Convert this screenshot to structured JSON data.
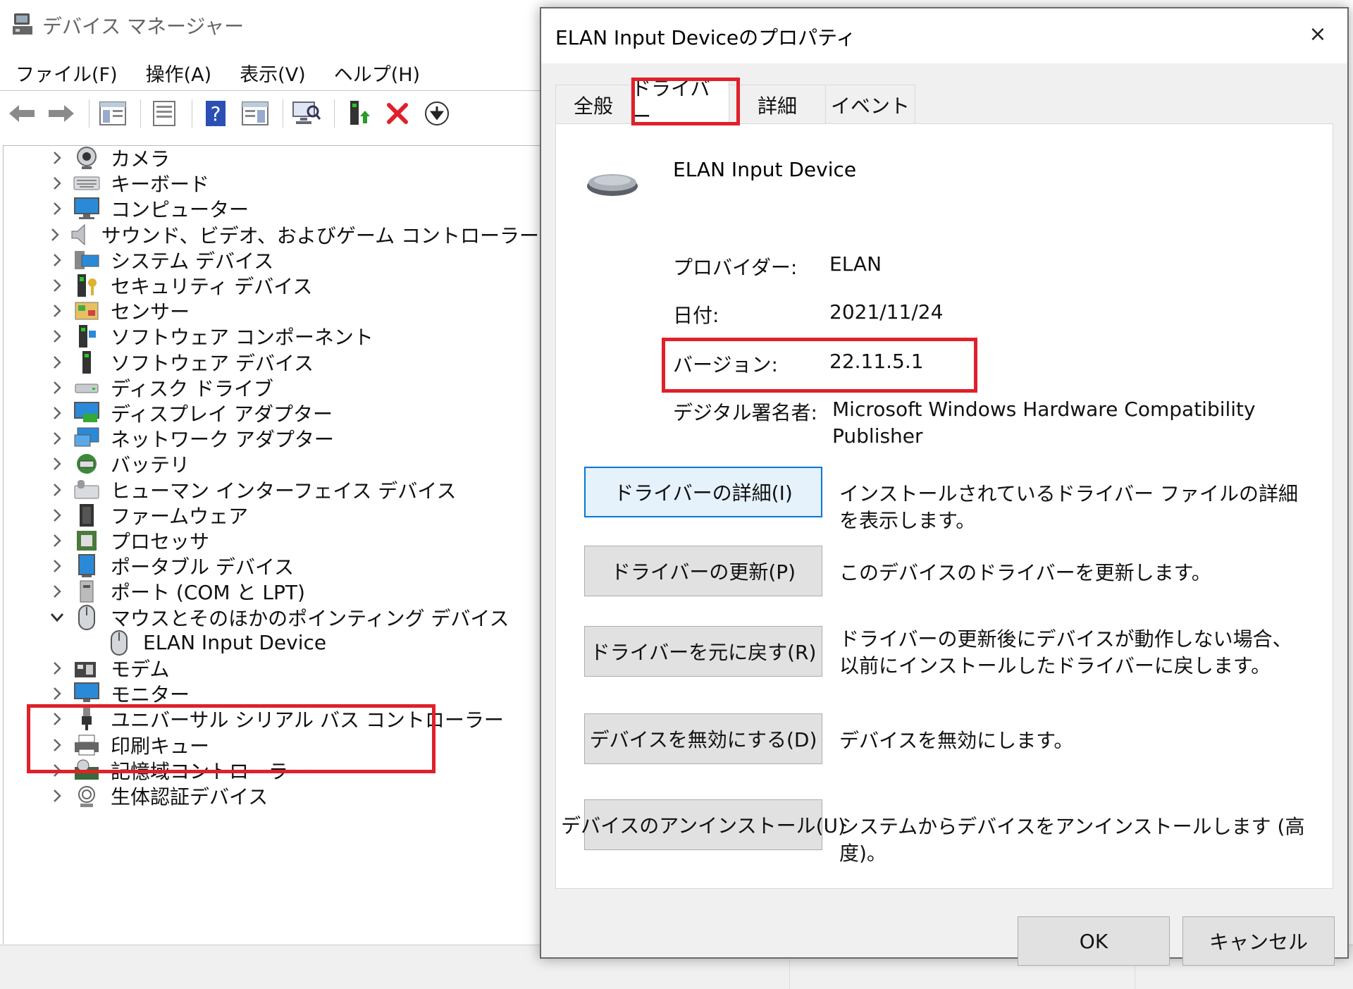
{
  "device_manager": {
    "title": "デバイス マネージャー",
    "menu": [
      "ファイル(F)",
      "操作(A)",
      "表示(V)",
      "ヘルプ(H)"
    ],
    "toolbar_icons": [
      "back-arrow-icon",
      "forward-arrow-icon",
      "show-hide-tree-icon",
      "properties-icon",
      "help-icon",
      "action-pane-icon",
      "scan-hardware-icon",
      "update-driver-icon",
      "uninstall-icon",
      "download-icon"
    ],
    "tree": [
      {
        "label": "カメラ",
        "icon": "camera-icon"
      },
      {
        "label": "キーボード",
        "icon": "keyboard-icon"
      },
      {
        "label": "コンピューター",
        "icon": "computer-icon"
      },
      {
        "label": "サウンド、ビデオ、およびゲーム コントローラー",
        "icon": "speaker-icon"
      },
      {
        "label": "システム デバイス",
        "icon": "system-devices-icon"
      },
      {
        "label": "セキュリティ デバイス",
        "icon": "security-key-icon"
      },
      {
        "label": "センサー",
        "icon": "sensor-icon"
      },
      {
        "label": "ソフトウェア コンポーネント",
        "icon": "software-component-icon"
      },
      {
        "label": "ソフトウェア デバイス",
        "icon": "software-device-icon"
      },
      {
        "label": "ディスク ドライブ",
        "icon": "disk-drive-icon"
      },
      {
        "label": "ディスプレイ アダプター",
        "icon": "display-adapter-icon"
      },
      {
        "label": "ネットワーク アダプター",
        "icon": "network-adapter-icon"
      },
      {
        "label": "バッテリ",
        "icon": "battery-icon"
      },
      {
        "label": "ヒューマン インターフェイス デバイス",
        "icon": "hid-icon"
      },
      {
        "label": "ファームウェア",
        "icon": "firmware-icon"
      },
      {
        "label": "プロセッサ",
        "icon": "processor-icon"
      },
      {
        "label": "ポータブル デバイス",
        "icon": "portable-device-icon"
      },
      {
        "label": "ポート (COM と LPT)",
        "icon": "port-icon"
      },
      {
        "label": "マウスとそのほかのポインティング デバイス",
        "icon": "mouse-icon",
        "expanded": true
      },
      {
        "label": "ELAN Input Device",
        "icon": "mouse-icon",
        "child": true
      },
      {
        "label": "モデム",
        "icon": "modem-icon"
      },
      {
        "label": "モニター",
        "icon": "monitor-icon"
      },
      {
        "label": "ユニバーサル シリアル バス コントローラー",
        "icon": "usb-icon"
      },
      {
        "label": "印刷キュー",
        "icon": "printer-icon"
      },
      {
        "label": "記憶域コントローラー",
        "icon": "storage-controller-icon"
      },
      {
        "label": "生体認証デバイス",
        "icon": "biometric-icon"
      }
    ]
  },
  "dialog": {
    "title": "ELAN Input Deviceのプロパティ",
    "close": "×",
    "tabs": [
      "全般",
      "ドライバー",
      "詳細",
      "イベント"
    ],
    "active_tab": "ドライバー",
    "device_name": "ELAN Input Device",
    "properties": {
      "provider_label": "プロバイダー:",
      "provider_value": "ELAN",
      "date_label": "日付:",
      "date_value": "2021/11/24",
      "version_label": "バージョン:",
      "version_value": "22.11.5.1",
      "signer_label": "デジタル署名者:",
      "signer_value_line1": "Microsoft Windows Hardware Compatibility",
      "signer_value_line2": "Publisher"
    },
    "buttons": [
      {
        "label": "ドライバーの詳細(I)",
        "desc": "インストールされているドライバー ファイルの詳細を表示します。"
      },
      {
        "label": "ドライバーの更新(P)",
        "desc": "このデバイスのドライバーを更新します。"
      },
      {
        "label": "ドライバーを元に戻す(R)",
        "desc": "ドライバーの更新後にデバイスが動作しない場合、以前にインストールしたドライバーに戻します。"
      },
      {
        "label": "デバイスを無効にする(D)",
        "desc": "デバイスを無効にします。"
      },
      {
        "label": "デバイスのアンインストール(U)",
        "desc": "システムからデバイスをアンインストールします (高度)。"
      }
    ],
    "ok": "OK",
    "cancel": "キャンセル"
  },
  "colors": {
    "highlight_red": "#e0202a",
    "focus_blue": "#0078d7"
  }
}
